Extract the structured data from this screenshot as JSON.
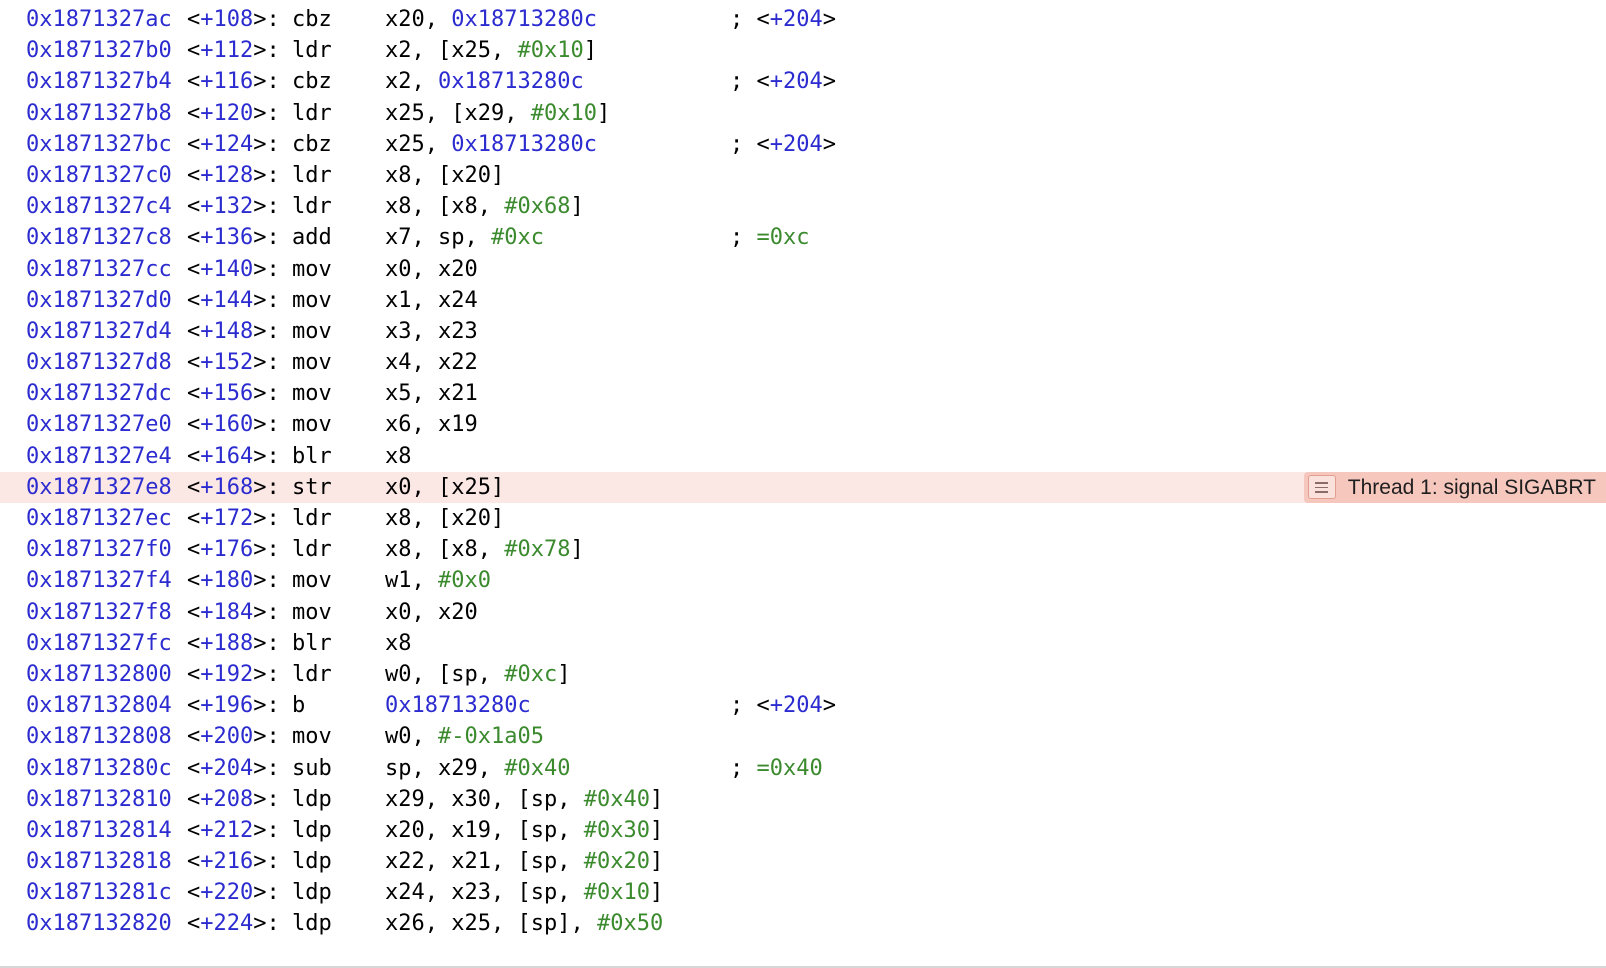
{
  "disassembly": {
    "lines": [
      {
        "address": "0x1871327ac",
        "offset": "+108",
        "mnemonic": "cbz",
        "operands": [
          [
            "reg",
            "x20"
          ],
          [
            "p",
            ", "
          ],
          [
            "addr",
            "0x18713280c"
          ]
        ],
        "comment": [
          "branch",
          "+204"
        ]
      },
      {
        "address": "0x1871327b0",
        "offset": "+112",
        "mnemonic": "ldr",
        "operands": [
          [
            "reg",
            "x2"
          ],
          [
            "p",
            ", ["
          ],
          [
            "reg",
            "x25"
          ],
          [
            "p",
            ", "
          ],
          [
            "imm",
            "#0x10"
          ],
          [
            "p",
            "]"
          ]
        ],
        "comment": null
      },
      {
        "address": "0x1871327b4",
        "offset": "+116",
        "mnemonic": "cbz",
        "operands": [
          [
            "reg",
            "x2"
          ],
          [
            "p",
            ", "
          ],
          [
            "addr",
            "0x18713280c"
          ]
        ],
        "comment": [
          "branch",
          "+204"
        ]
      },
      {
        "address": "0x1871327b8",
        "offset": "+120",
        "mnemonic": "ldr",
        "operands": [
          [
            "reg",
            "x25"
          ],
          [
            "p",
            ", ["
          ],
          [
            "reg",
            "x29"
          ],
          [
            "p",
            ", "
          ],
          [
            "imm",
            "#0x10"
          ],
          [
            "p",
            "]"
          ]
        ],
        "comment": null
      },
      {
        "address": "0x1871327bc",
        "offset": "+124",
        "mnemonic": "cbz",
        "operands": [
          [
            "reg",
            "x25"
          ],
          [
            "p",
            ", "
          ],
          [
            "addr",
            "0x18713280c"
          ]
        ],
        "comment": [
          "branch",
          "+204"
        ]
      },
      {
        "address": "0x1871327c0",
        "offset": "+128",
        "mnemonic": "ldr",
        "operands": [
          [
            "reg",
            "x8"
          ],
          [
            "p",
            ", ["
          ],
          [
            "reg",
            "x20"
          ],
          [
            "p",
            "]"
          ]
        ],
        "comment": null
      },
      {
        "address": "0x1871327c4",
        "offset": "+132",
        "mnemonic": "ldr",
        "operands": [
          [
            "reg",
            "x8"
          ],
          [
            "p",
            ", ["
          ],
          [
            "reg",
            "x8"
          ],
          [
            "p",
            ", "
          ],
          [
            "imm",
            "#0x68"
          ],
          [
            "p",
            "]"
          ]
        ],
        "comment": null
      },
      {
        "address": "0x1871327c8",
        "offset": "+136",
        "mnemonic": "add",
        "operands": [
          [
            "reg",
            "x7"
          ],
          [
            "p",
            ", "
          ],
          [
            "reg",
            "sp"
          ],
          [
            "p",
            ", "
          ],
          [
            "imm",
            "#0xc"
          ]
        ],
        "comment": [
          "value",
          "=0xc"
        ]
      },
      {
        "address": "0x1871327cc",
        "offset": "+140",
        "mnemonic": "mov",
        "operands": [
          [
            "reg",
            "x0"
          ],
          [
            "p",
            ", "
          ],
          [
            "reg",
            "x20"
          ]
        ],
        "comment": null
      },
      {
        "address": "0x1871327d0",
        "offset": "+144",
        "mnemonic": "mov",
        "operands": [
          [
            "reg",
            "x1"
          ],
          [
            "p",
            ", "
          ],
          [
            "reg",
            "x24"
          ]
        ],
        "comment": null
      },
      {
        "address": "0x1871327d4",
        "offset": "+148",
        "mnemonic": "mov",
        "operands": [
          [
            "reg",
            "x3"
          ],
          [
            "p",
            ", "
          ],
          [
            "reg",
            "x23"
          ]
        ],
        "comment": null
      },
      {
        "address": "0x1871327d8",
        "offset": "+152",
        "mnemonic": "mov",
        "operands": [
          [
            "reg",
            "x4"
          ],
          [
            "p",
            ", "
          ],
          [
            "reg",
            "x22"
          ]
        ],
        "comment": null
      },
      {
        "address": "0x1871327dc",
        "offset": "+156",
        "mnemonic": "mov",
        "operands": [
          [
            "reg",
            "x5"
          ],
          [
            "p",
            ", "
          ],
          [
            "reg",
            "x21"
          ]
        ],
        "comment": null
      },
      {
        "address": "0x1871327e0",
        "offset": "+160",
        "mnemonic": "mov",
        "operands": [
          [
            "reg",
            "x6"
          ],
          [
            "p",
            ", "
          ],
          [
            "reg",
            "x19"
          ]
        ],
        "comment": null
      },
      {
        "address": "0x1871327e4",
        "offset": "+164",
        "mnemonic": "blr",
        "operands": [
          [
            "reg",
            "x8"
          ]
        ],
        "comment": null
      },
      {
        "address": "0x1871327e8",
        "offset": "+168",
        "mnemonic": "str",
        "operands": [
          [
            "reg",
            "x0"
          ],
          [
            "p",
            ", ["
          ],
          [
            "reg",
            "x25"
          ],
          [
            "p",
            "]"
          ]
        ],
        "comment": null,
        "current": true
      },
      {
        "address": "0x1871327ec",
        "offset": "+172",
        "mnemonic": "ldr",
        "operands": [
          [
            "reg",
            "x8"
          ],
          [
            "p",
            ", ["
          ],
          [
            "reg",
            "x20"
          ],
          [
            "p",
            "]"
          ]
        ],
        "comment": null
      },
      {
        "address": "0x1871327f0",
        "offset": "+176",
        "mnemonic": "ldr",
        "operands": [
          [
            "reg",
            "x8"
          ],
          [
            "p",
            ", ["
          ],
          [
            "reg",
            "x8"
          ],
          [
            "p",
            ", "
          ],
          [
            "imm",
            "#0x78"
          ],
          [
            "p",
            "]"
          ]
        ],
        "comment": null
      },
      {
        "address": "0x1871327f4",
        "offset": "+180",
        "mnemonic": "mov",
        "operands": [
          [
            "reg",
            "w1"
          ],
          [
            "p",
            ", "
          ],
          [
            "imm",
            "#0x0"
          ]
        ],
        "comment": null
      },
      {
        "address": "0x1871327f8",
        "offset": "+184",
        "mnemonic": "mov",
        "operands": [
          [
            "reg",
            "x0"
          ],
          [
            "p",
            ", "
          ],
          [
            "reg",
            "x20"
          ]
        ],
        "comment": null
      },
      {
        "address": "0x1871327fc",
        "offset": "+188",
        "mnemonic": "blr",
        "operands": [
          [
            "reg",
            "x8"
          ]
        ],
        "comment": null
      },
      {
        "address": "0x187132800",
        "offset": "+192",
        "mnemonic": "ldr",
        "operands": [
          [
            "reg",
            "w0"
          ],
          [
            "p",
            ", ["
          ],
          [
            "reg",
            "sp"
          ],
          [
            "p",
            ", "
          ],
          [
            "imm",
            "#0xc"
          ],
          [
            "p",
            "]"
          ]
        ],
        "comment": null
      },
      {
        "address": "0x187132804",
        "offset": "+196",
        "mnemonic": "b",
        "operands": [
          [
            "addr",
            "0x18713280c"
          ]
        ],
        "comment": [
          "branch",
          "+204"
        ]
      },
      {
        "address": "0x187132808",
        "offset": "+200",
        "mnemonic": "mov",
        "operands": [
          [
            "reg",
            "w0"
          ],
          [
            "p",
            ", "
          ],
          [
            "imm",
            "#-0x1a05"
          ]
        ],
        "comment": null
      },
      {
        "address": "0x18713280c",
        "offset": "+204",
        "mnemonic": "sub",
        "operands": [
          [
            "reg",
            "sp"
          ],
          [
            "p",
            ", "
          ],
          [
            "reg",
            "x29"
          ],
          [
            "p",
            ", "
          ],
          [
            "imm",
            "#0x40"
          ]
        ],
        "comment": [
          "value",
          "=0x40"
        ]
      },
      {
        "address": "0x187132810",
        "offset": "+208",
        "mnemonic": "ldp",
        "operands": [
          [
            "reg",
            "x29"
          ],
          [
            "p",
            ", "
          ],
          [
            "reg",
            "x30"
          ],
          [
            "p",
            ", ["
          ],
          [
            "reg",
            "sp"
          ],
          [
            "p",
            ", "
          ],
          [
            "imm",
            "#0x40"
          ],
          [
            "p",
            "]"
          ]
        ],
        "comment": null
      },
      {
        "address": "0x187132814",
        "offset": "+212",
        "mnemonic": "ldp",
        "operands": [
          [
            "reg",
            "x20"
          ],
          [
            "p",
            ", "
          ],
          [
            "reg",
            "x19"
          ],
          [
            "p",
            ", ["
          ],
          [
            "reg",
            "sp"
          ],
          [
            "p",
            ", "
          ],
          [
            "imm",
            "#0x30"
          ],
          [
            "p",
            "]"
          ]
        ],
        "comment": null
      },
      {
        "address": "0x187132818",
        "offset": "+216",
        "mnemonic": "ldp",
        "operands": [
          [
            "reg",
            "x22"
          ],
          [
            "p",
            ", "
          ],
          [
            "reg",
            "x21"
          ],
          [
            "p",
            ", ["
          ],
          [
            "reg",
            "sp"
          ],
          [
            "p",
            ", "
          ],
          [
            "imm",
            "#0x20"
          ],
          [
            "p",
            "]"
          ]
        ],
        "comment": null
      },
      {
        "address": "0x18713281c",
        "offset": "+220",
        "mnemonic": "ldp",
        "operands": [
          [
            "reg",
            "x24"
          ],
          [
            "p",
            ", "
          ],
          [
            "reg",
            "x23"
          ],
          [
            "p",
            ", ["
          ],
          [
            "reg",
            "sp"
          ],
          [
            "p",
            ", "
          ],
          [
            "imm",
            "#0x10"
          ],
          [
            "p",
            "]"
          ]
        ],
        "comment": null
      },
      {
        "address": "0x187132820",
        "offset": "+224",
        "mnemonic": "ldp",
        "operands": [
          [
            "reg",
            "x26"
          ],
          [
            "p",
            ", "
          ],
          [
            "reg",
            "x25"
          ],
          [
            "p",
            ", ["
          ],
          [
            "reg",
            "sp"
          ],
          [
            "p",
            "], "
          ],
          [
            "imm",
            "#0x50"
          ]
        ],
        "comment": null
      }
    ]
  },
  "thread_badge": {
    "label": "Thread 1: signal SIGABRT",
    "icon": "menu-lines-icon"
  },
  "colors": {
    "address": "#2b2bd0",
    "immediate": "#3b8a2e",
    "current_line_bg": "#fbe7e3",
    "badge_bg": "#f5c7bd"
  }
}
